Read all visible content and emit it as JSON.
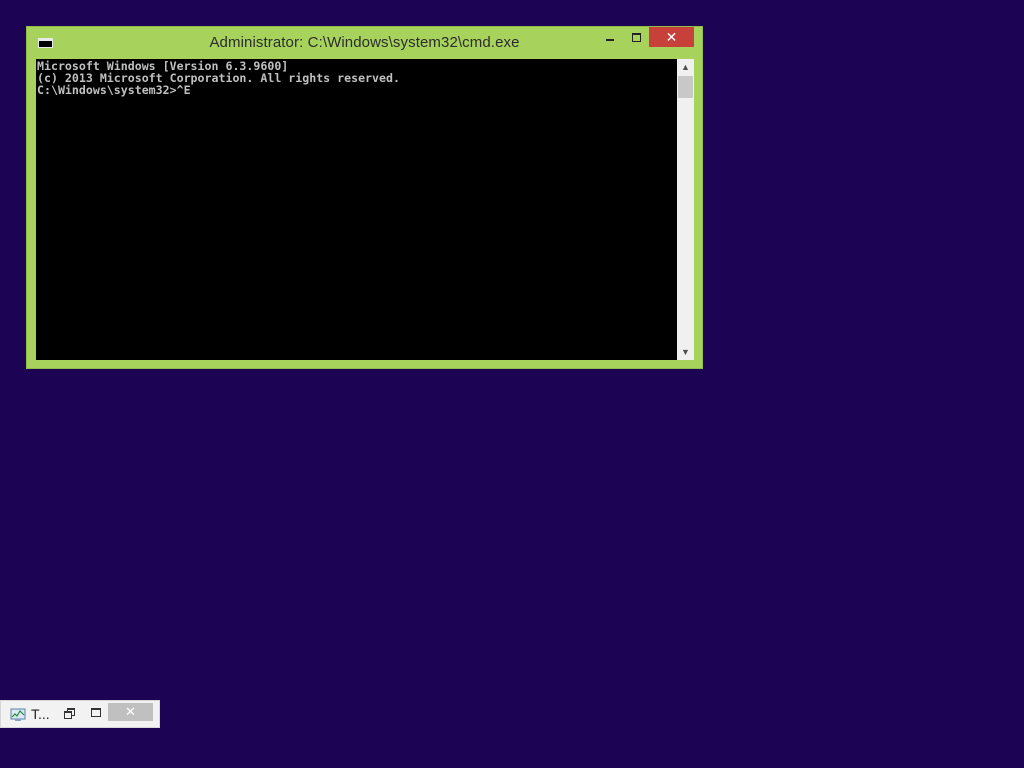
{
  "cmd_window": {
    "title": "Administrator: C:\\Windows\\system32\\cmd.exe",
    "icon_text": "C:\\.",
    "minimize_glyph": "minimize-icon",
    "maximize_glyph": "maximize-icon",
    "close_glyph": "✕",
    "console_lines": [
      "Microsoft Windows [Version 6.3.9600]",
      "(c) 2013 Microsoft Corporation. All rights reserved.",
      "C:\\Windows\\system32>^E"
    ],
    "scroll_up": "▲",
    "scroll_down": "▼"
  },
  "minimized_window": {
    "icon": "task-manager-icon",
    "label": "T...",
    "close_glyph": "✕"
  },
  "colors": {
    "desktop": "#1c0354",
    "window_frame": "#a7d35d",
    "close_button": "#c7403a",
    "console_bg": "#000000",
    "console_text": "#c0c0c0"
  }
}
